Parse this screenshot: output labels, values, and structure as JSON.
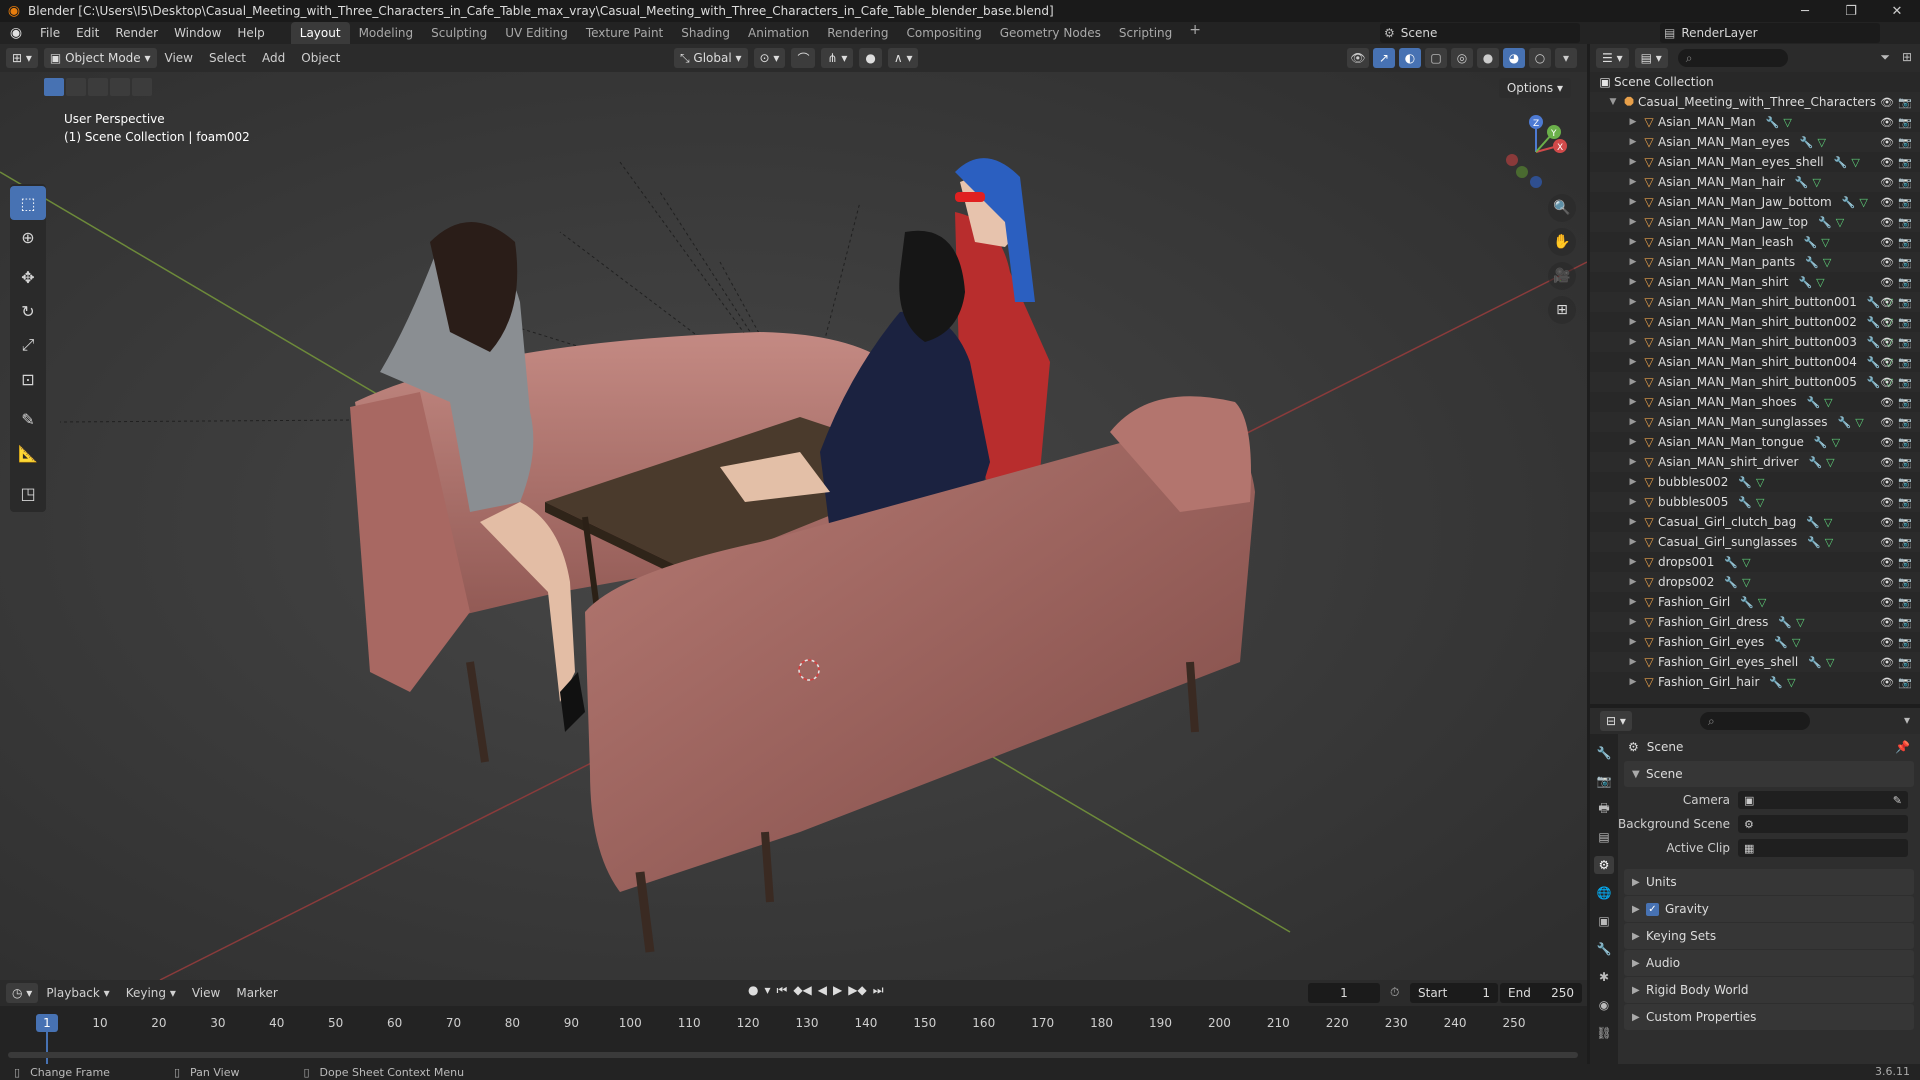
{
  "window": {
    "title": "Blender [C:\\Users\\I5\\Desktop\\Casual_Meeting_with_Three_Characters_in_Cafe_Table_max_vray\\Casual_Meeting_with_Three_Characters_in_Cafe_Table_blender_base.blend]"
  },
  "menu": [
    "File",
    "Edit",
    "Render",
    "Window",
    "Help"
  ],
  "workspaces": [
    "Layout",
    "Modeling",
    "Sculpting",
    "UV Editing",
    "Texture Paint",
    "Shading",
    "Animation",
    "Rendering",
    "Compositing",
    "Geometry Nodes",
    "Scripting"
  ],
  "scene_name": "Scene",
  "render_layer": "RenderLayer",
  "viewport": {
    "mode": "Object Mode",
    "menus": [
      "View",
      "Select",
      "Add",
      "Object"
    ],
    "orientation": "Global",
    "options_label": "Options",
    "info_line1": "User Perspective",
    "info_line2": "(1) Scene Collection | foam002"
  },
  "outliner": {
    "root": "Scene Collection",
    "collection": "Casual_Meeting_with_Three_Characters",
    "items": [
      "Asian_MAN_Man",
      "Asian_MAN_Man_eyes",
      "Asian_MAN_Man_eyes_shell",
      "Asian_MAN_Man_hair",
      "Asian_MAN_Man_Jaw_bottom",
      "Asian_MAN_Man_Jaw_top",
      "Asian_MAN_Man_leash",
      "Asian_MAN_Man_pants",
      "Asian_MAN_Man_shirt",
      "Asian_MAN_Man_shirt_button001",
      "Asian_MAN_Man_shirt_button002",
      "Asian_MAN_Man_shirt_button003",
      "Asian_MAN_Man_shirt_button004",
      "Asian_MAN_Man_shirt_button005",
      "Asian_MAN_Man_shoes",
      "Asian_MAN_Man_sunglasses",
      "Asian_MAN_Man_tongue",
      "Asian_MAN_shirt_driver",
      "bubbles002",
      "bubbles005",
      "Casual_Girl_clutch_bag",
      "Casual_Girl_sunglasses",
      "drops001",
      "drops002",
      "Fashion_Girl",
      "Fashion_Girl_dress",
      "Fashion_Girl_eyes",
      "Fashion_Girl_eyes_shell",
      "Fashion_Girl_hair"
    ]
  },
  "properties": {
    "title": "Scene",
    "panel_scene": "Scene",
    "camera_label": "Camera",
    "background_scene_label": "Background Scene",
    "active_clip_label": "Active Clip",
    "panels": [
      "Units",
      "Gravity",
      "Keying Sets",
      "Audio",
      "Rigid Body World",
      "Custom Properties"
    ]
  },
  "timeline": {
    "menus": [
      "Playback",
      "Keying",
      "View",
      "Marker"
    ],
    "current_frame": "1",
    "start_label": "Start",
    "start": "1",
    "end_label": "End",
    "end": "250",
    "ticks": [
      "10",
      "20",
      "30",
      "40",
      "50",
      "60",
      "70",
      "80",
      "90",
      "100",
      "110",
      "120",
      "130",
      "140",
      "150",
      "160",
      "170",
      "180",
      "190",
      "200",
      "210",
      "220",
      "230",
      "240",
      "250"
    ]
  },
  "status": {
    "left": "Change Frame",
    "middle": "Pan View",
    "right": "Dope Sheet Context Menu",
    "version": "3.6.11"
  }
}
